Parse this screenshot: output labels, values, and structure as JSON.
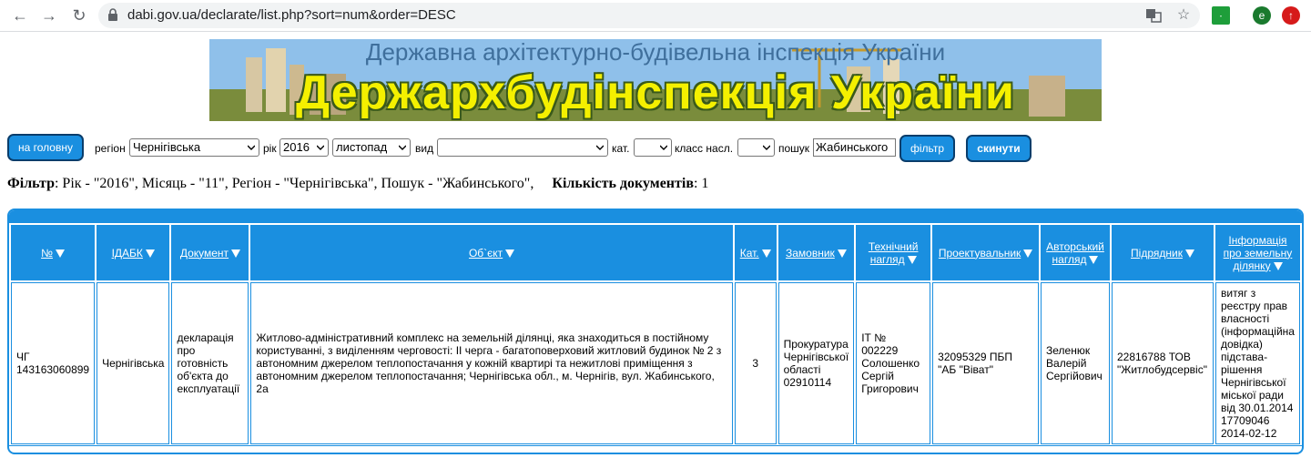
{
  "browser": {
    "url": "dabi.gov.ua/declarate/list.php?sort=num&order=DESC",
    "ext_profile_letter": "e"
  },
  "banner": {
    "top_text": "Державна архітектурно-будівельна інспекція України",
    "main_text": "Держархбудінспекція України"
  },
  "controls": {
    "home_button": "на головну",
    "region_label": "регіон",
    "region_value": "Чернігівська",
    "year_label": "рік",
    "year_value": "2016",
    "month_value": "листопад",
    "type_label": "вид",
    "type_value": "",
    "cat_label": "кат.",
    "cat_value": "",
    "class_label": "класс насл.",
    "class_value": "",
    "search_label": "пошук",
    "search_value": "Жабинського",
    "filter_button": "фільтр",
    "reset_button": "скинути"
  },
  "filter_summary": {
    "filter_label": "Фільтр",
    "filter_text": ": Рік - \"2016\", Місяць - \"11\", Регіон - \"Чернігівська\", Пошук - \"Жабинського\",",
    "count_label": "Кількість документів",
    "count_text": ": 1"
  },
  "table": {
    "headers": [
      "№",
      "ІДАБК",
      "Документ",
      "Об`єкт",
      "Кат.",
      "Замовник",
      "Технічний нагляд",
      "Проектувальник",
      "Авторський нагляд",
      "Підрядник",
      "Інформація про земельну ділянку"
    ],
    "rows": [
      {
        "num": "ЧГ 143163060899",
        "idabk": "Чернігівська",
        "document": "декларація про готовність об'єкта до експлуатації",
        "object": "Житлово-адміністративний комплекс на земельній ділянці, яка знаходиться в постійному користуванні, з виділенням черговості: ІІ черга - багатоповерховий житловий будинок № 2 з автономним джерелом теплопостачання у кожній квартирі та нежитлові приміщення з автономним джерелом теплопостачання; Чернігівська обл., м. Чернігів, вул. Жабинського, 2а",
        "cat": "3",
        "customer": "Прокуратура Чернігівської області 02910114",
        "tech_supervision": "ІТ № 002229 Солошенко Сергій Григорович",
        "designer": "32095329 ПБП \"АБ \"Віват\"",
        "author_supervision": "Зеленюк Валерій Сергійович",
        "contractor": "22816788 ТОВ \"Житлобудсервіс\"",
        "land_info": "витяг з реєстру прав власності (інформаційна довідка) підстава-рішення Чернігівської міської ради від 30.01.2014 17709046 2014-02-12"
      }
    ]
  },
  "colors": {
    "accent": "#1a8fe0",
    "button_border": "#0a3d6b"
  }
}
